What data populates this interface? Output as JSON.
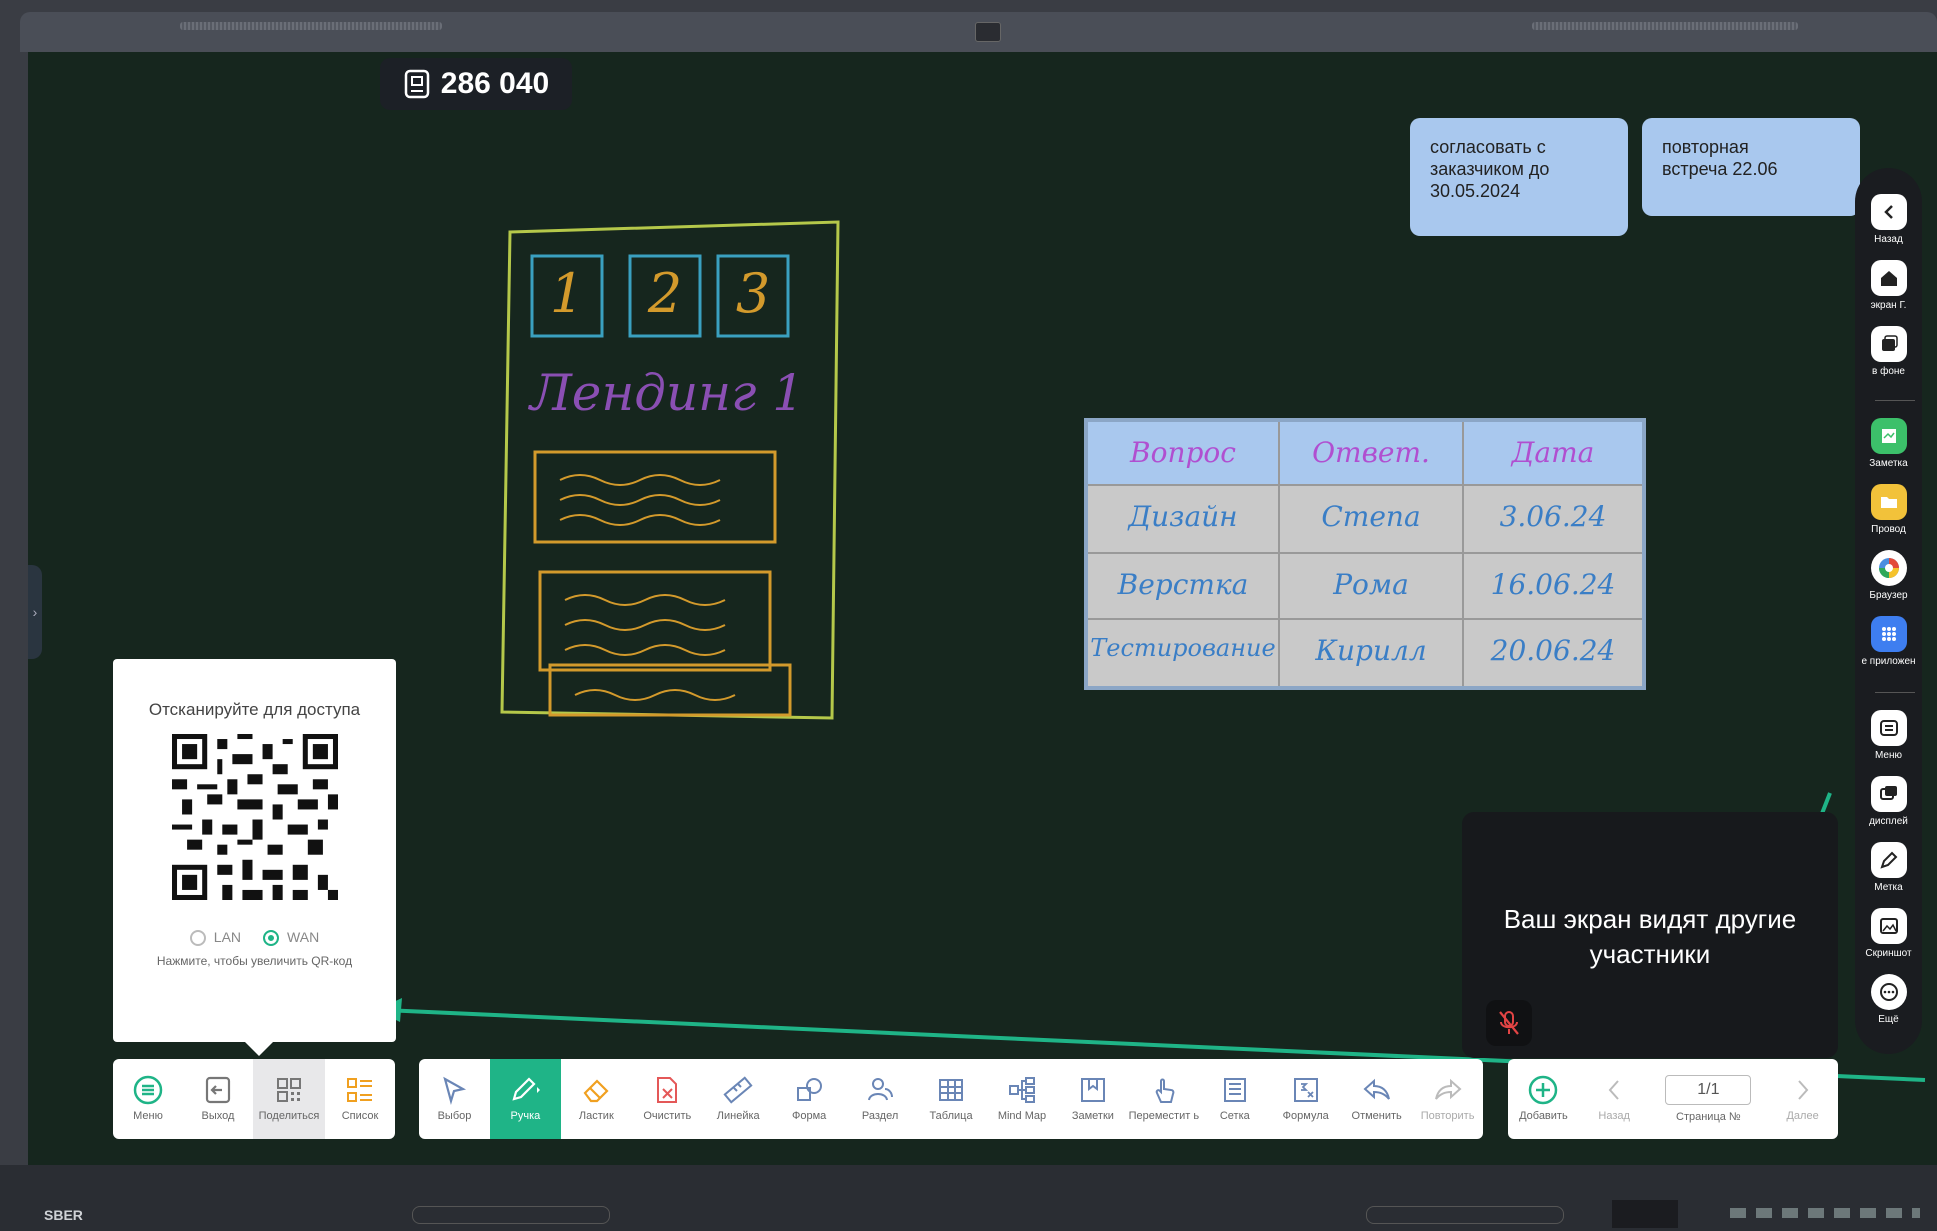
{
  "brand": "SBER",
  "session": {
    "code": "286 040"
  },
  "notes": [
    {
      "text": "согласовать с\nзаказчиком до\n30.05.2024"
    },
    {
      "text": "повторная\nвстреча 22.06"
    }
  ],
  "handwriting": {
    "boxes": [
      "1",
      "2",
      "3"
    ],
    "title": "Лендинг 1"
  },
  "table": {
    "headers": [
      "Вопрос",
      "Ответ.",
      "Дата"
    ],
    "rows": [
      [
        "Дизайн",
        "Степа",
        "3.06.24"
      ],
      [
        "Верстка",
        "Рома",
        "16.06.24"
      ],
      [
        "Тестирование",
        "Кирилл",
        "20.06.24"
      ]
    ]
  },
  "qr_panel": {
    "title": "Отсканируйте для доступа",
    "lan_label": "LAN",
    "wan_label": "WAN",
    "selected": "WAN",
    "hint": "Нажмите, чтобы увеличить QR-код"
  },
  "toolbar_left": [
    {
      "label": "Меню",
      "icon": "menu-icon"
    },
    {
      "label": "Выход",
      "icon": "exit-icon"
    },
    {
      "label": "Поделиться",
      "icon": "share-grid-icon"
    },
    {
      "label": "Список",
      "icon": "list-icon"
    }
  ],
  "toolbar_main": [
    {
      "label": "Выбор",
      "icon": "cursor-icon"
    },
    {
      "label": "Ручка",
      "icon": "pen-icon"
    },
    {
      "label": "Ластик",
      "icon": "eraser-icon"
    },
    {
      "label": "Очистить",
      "icon": "clear-icon"
    },
    {
      "label": "Линейка",
      "icon": "ruler-icon"
    },
    {
      "label": "Форма",
      "icon": "shape-icon"
    },
    {
      "label": "Раздел",
      "icon": "users-icon"
    },
    {
      "label": "Таблица",
      "icon": "table-icon"
    },
    {
      "label": "Mind Map",
      "icon": "mindmap-icon"
    },
    {
      "label": "Заметки",
      "icon": "notes-icon"
    },
    {
      "label": "Переместит ь",
      "icon": "move-icon"
    },
    {
      "label": "Сетка",
      "icon": "grid-icon"
    },
    {
      "label": "Формула",
      "icon": "formula-icon"
    },
    {
      "label": "Отменить",
      "icon": "undo-icon"
    },
    {
      "label": "Повторить",
      "icon": "redo-icon"
    }
  ],
  "toolbar_right": {
    "add": "Добавить",
    "back": "Назад",
    "page": "1/1",
    "page_label": "Страница №",
    "next": "Далее"
  },
  "share_popup": {
    "text": "Ваш экран видят другие участники"
  },
  "rail": {
    "items": [
      {
        "label": "Назад",
        "icon": "chevron-left-icon"
      },
      {
        "label": "экран Г.",
        "icon": "home-icon"
      },
      {
        "label": "в фоне",
        "icon": "windows-icon"
      },
      {
        "label": "Заметка",
        "icon": "note-app-icon"
      },
      {
        "label": "Провод",
        "icon": "folder-icon"
      },
      {
        "label": "Браузер",
        "icon": "browser-icon"
      },
      {
        "label": "е приложен",
        "icon": "apps-icon"
      },
      {
        "label": "Меню",
        "icon": "menu-square-icon"
      },
      {
        "label": "дисплей",
        "icon": "display-icon"
      },
      {
        "label": "Метка",
        "icon": "marker-icon"
      },
      {
        "label": "Скриншот",
        "icon": "screenshot-icon"
      },
      {
        "label": "Ещё",
        "icon": "more-icon"
      }
    ]
  },
  "colors": {
    "accent": "#1fb487",
    "board": "#16261e",
    "note": "#a9c8ee",
    "arrow": "#1fb487"
  }
}
